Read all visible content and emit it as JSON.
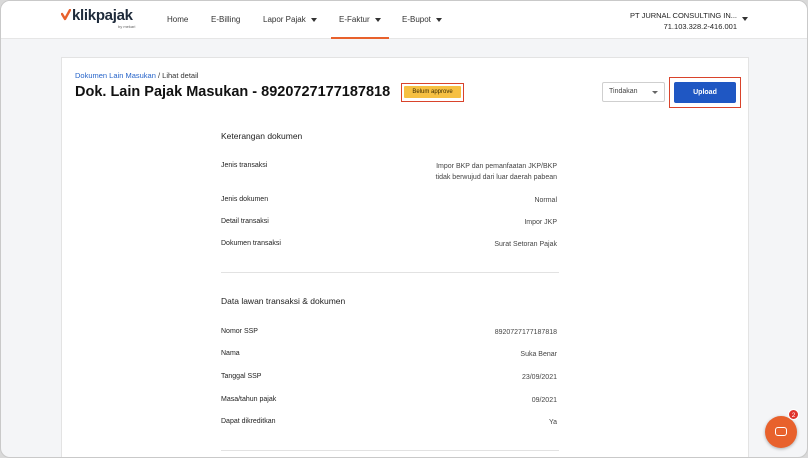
{
  "brand": {
    "name": "klikpajak",
    "sub": "by mekari",
    "accent": "#e8612c"
  },
  "nav": {
    "items": [
      {
        "label": "Home"
      },
      {
        "label": "E-Billing"
      },
      {
        "label": "Lapor Pajak"
      },
      {
        "label": "E-Faktur"
      },
      {
        "label": "E-Bupot"
      }
    ],
    "active": "E-Faktur"
  },
  "account": {
    "company": "PT JURNAL CONSULTING IN...",
    "npwp": "71.103.328.2-416.001"
  },
  "breadcrumb": {
    "link": "Dokumen Lain Masukan",
    "separator": " / ",
    "current": "Lihat detail"
  },
  "page": {
    "title": "Dok. Lain Pajak Masukan - 8920727177187818",
    "status": "Belum approve",
    "status_color": "#f6c042",
    "action_select": "Tindakan",
    "upload_label": "Upload",
    "upload_color": "#1f57c3"
  },
  "sections": {
    "doc_info": {
      "title": "Keterangan dokumen",
      "rows": [
        {
          "label": "Jenis transaksi",
          "value_line1": "Impor BKP dan pemanfaatan JKP/BKP",
          "value_line2": "tidak berwujud dari luar daerah pabean"
        },
        {
          "label": "Jenis dokumen",
          "value": "Normal"
        },
        {
          "label": "Detail transaksi",
          "value": "Impor JKP"
        },
        {
          "label": "Dokumen transaksi",
          "value": "Surat Setoran Pajak"
        }
      ]
    },
    "counterparty": {
      "title": "Data lawan transaksi & dokumen",
      "rows": [
        {
          "label": "Nomor SSP",
          "value": "8920727177187818"
        },
        {
          "label": "Nama",
          "value": "Suka Benar"
        },
        {
          "label": "Tanggal SSP",
          "value": "23/09/2021"
        },
        {
          "label": "Masa/tahun pajak",
          "value": "09/2021"
        },
        {
          "label": "Dapat dikreditkan",
          "value": "Ya"
        }
      ]
    }
  },
  "chat": {
    "badge": "2",
    "icon": "chat-icon"
  }
}
